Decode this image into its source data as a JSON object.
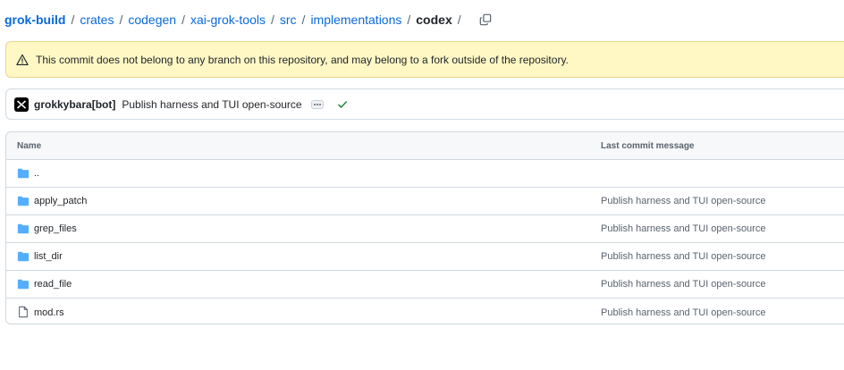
{
  "breadcrumb": {
    "items": [
      "grok-build",
      "crates",
      "codegen",
      "xai-grok-tools",
      "src",
      "implementations"
    ],
    "current": "codex",
    "separator": "/",
    "copy_icon": "copy-icon"
  },
  "banner": {
    "icon": "alert-icon",
    "text": "This commit does not belong to any branch on this repository, and may belong to a fork outside of the repository."
  },
  "commit": {
    "author": "grokkybara[bot]",
    "message": "Publish harness and TUI open-source",
    "status_icon": "check-icon"
  },
  "table": {
    "headers": {
      "name": "Name",
      "message": "Last commit message"
    },
    "rows": [
      {
        "type": "folder",
        "name": "..",
        "message": ""
      },
      {
        "type": "folder",
        "name": "apply_patch",
        "message": "Publish harness and TUI open-source"
      },
      {
        "type": "folder",
        "name": "grep_files",
        "message": "Publish harness and TUI open-source"
      },
      {
        "type": "folder",
        "name": "list_dir",
        "message": "Publish harness and TUI open-source"
      },
      {
        "type": "folder",
        "name": "read_file",
        "message": "Publish harness and TUI open-source"
      },
      {
        "type": "file",
        "name": "mod.rs",
        "message": "Publish harness and TUI open-source"
      }
    ]
  },
  "colors": {
    "link": "#0969da",
    "banner_bg": "#fff8c5",
    "folder": "#54aeff",
    "success": "#1a7f37"
  }
}
